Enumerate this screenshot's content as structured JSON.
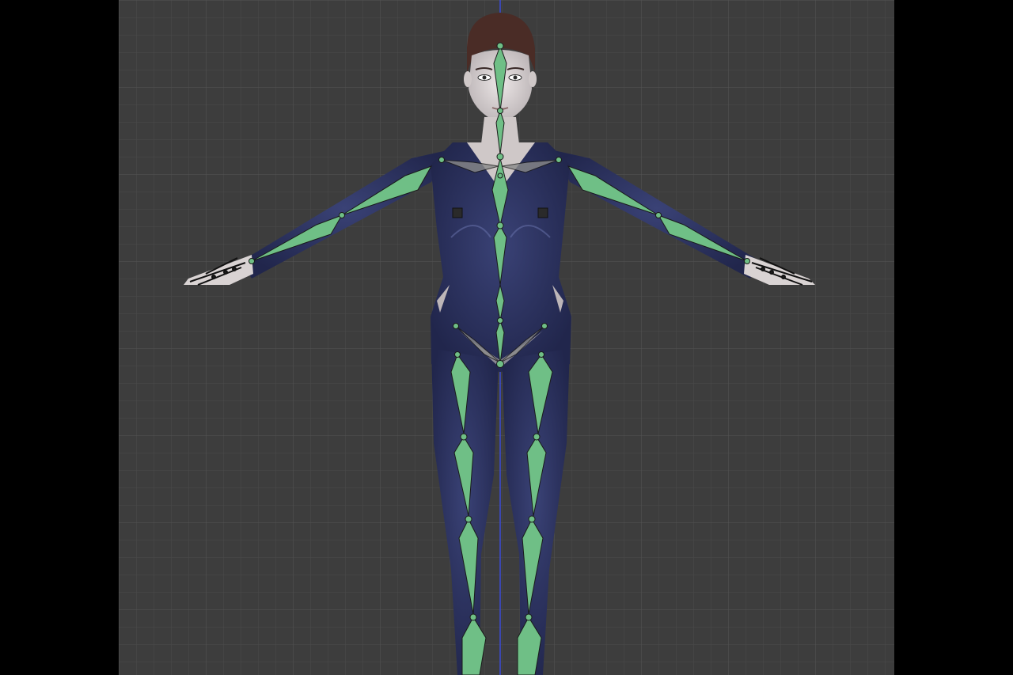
{
  "viewport": {
    "mode": "front-orthographic",
    "background_color": "#3d3d3d",
    "grid_color": "#4a4a4a",
    "grid_major_color": "#555555",
    "axis_color": "#3b4bd6",
    "letterbox_color": "#000000"
  },
  "model": {
    "suit_color": "#2a2f5c",
    "skin_color": "#d9d3d3",
    "hair_color": "#4a2c26"
  },
  "armature": {
    "display": "octahedral",
    "bone_color": "#6fbf86",
    "bone_outline_color": "#1a1a1a",
    "joint_color": "#6fbf86"
  }
}
